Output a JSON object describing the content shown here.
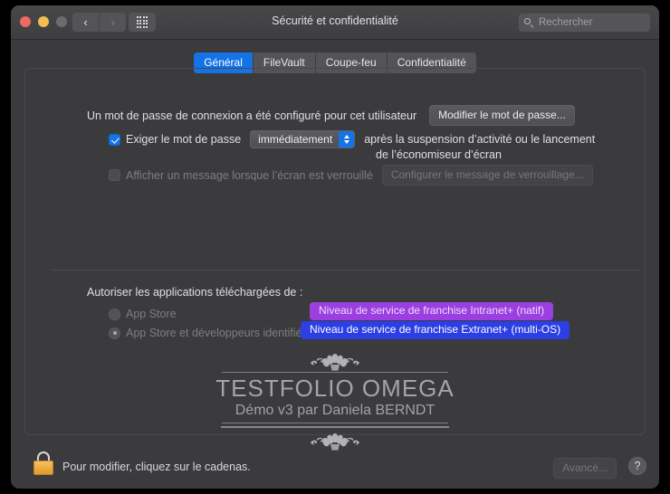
{
  "window": {
    "title": "Sécurité et confidentialité",
    "traffic_lights": [
      "close-red",
      "minimize-yellow",
      "zoom-disabled-gray"
    ],
    "nav": {
      "back_icon": "chevron-left-icon",
      "forward_icon": "chevron-right-icon",
      "grid_icon": "grid-view-icon"
    },
    "search": {
      "placeholder": "Rechercher",
      "value": "",
      "icon": "search-icon"
    }
  },
  "tabs": [
    {
      "label": "Général",
      "active": true
    },
    {
      "label": "FileVault",
      "active": false
    },
    {
      "label": "Coupe-feu",
      "active": false
    },
    {
      "label": "Confidentialité",
      "active": false
    }
  ],
  "general": {
    "password_status": "Un mot de passe de connexion a été configuré pour cet utilisateur",
    "change_password_button": "Modifier le mot de passe...",
    "require_password": {
      "checked": true,
      "label": "Exiger le mot de passe",
      "delay_value": "immédiatement",
      "suffix_line1": "après la suspension d’activité ou le lancement",
      "suffix_line2": "de l’économiseur d’écran"
    },
    "lock_message": {
      "checked": false,
      "enabled": false,
      "label": "Afficher un message lorsque l’écran est verrouillé",
      "button": "Configurer le message de verrouillage..."
    },
    "allow_apps": {
      "heading": "Autoriser les applications téléchargées de :",
      "options": [
        {
          "label": "App Store",
          "selected": false
        },
        {
          "label": "App Store et développeurs identifiés",
          "selected": true
        }
      ]
    }
  },
  "overlay_badges": [
    {
      "text": "Niveau de service de franchise Intranet+ (natif)",
      "color": "#9b3fe0"
    },
    {
      "text": "Niveau de service de franchise Extranet+ (multi-OS)",
      "color": "#2b3fe4"
    }
  ],
  "watermark": {
    "title": "TESTFOLIO OMEGA",
    "subtitle": "Démo v3 par Daniela BERNDT"
  },
  "footer": {
    "lock_icon": "lock-closed-icon",
    "lock_text": "Pour modifier, cliquez sur le cadenas.",
    "advanced_button": "Avancé...",
    "help_button": "?"
  }
}
